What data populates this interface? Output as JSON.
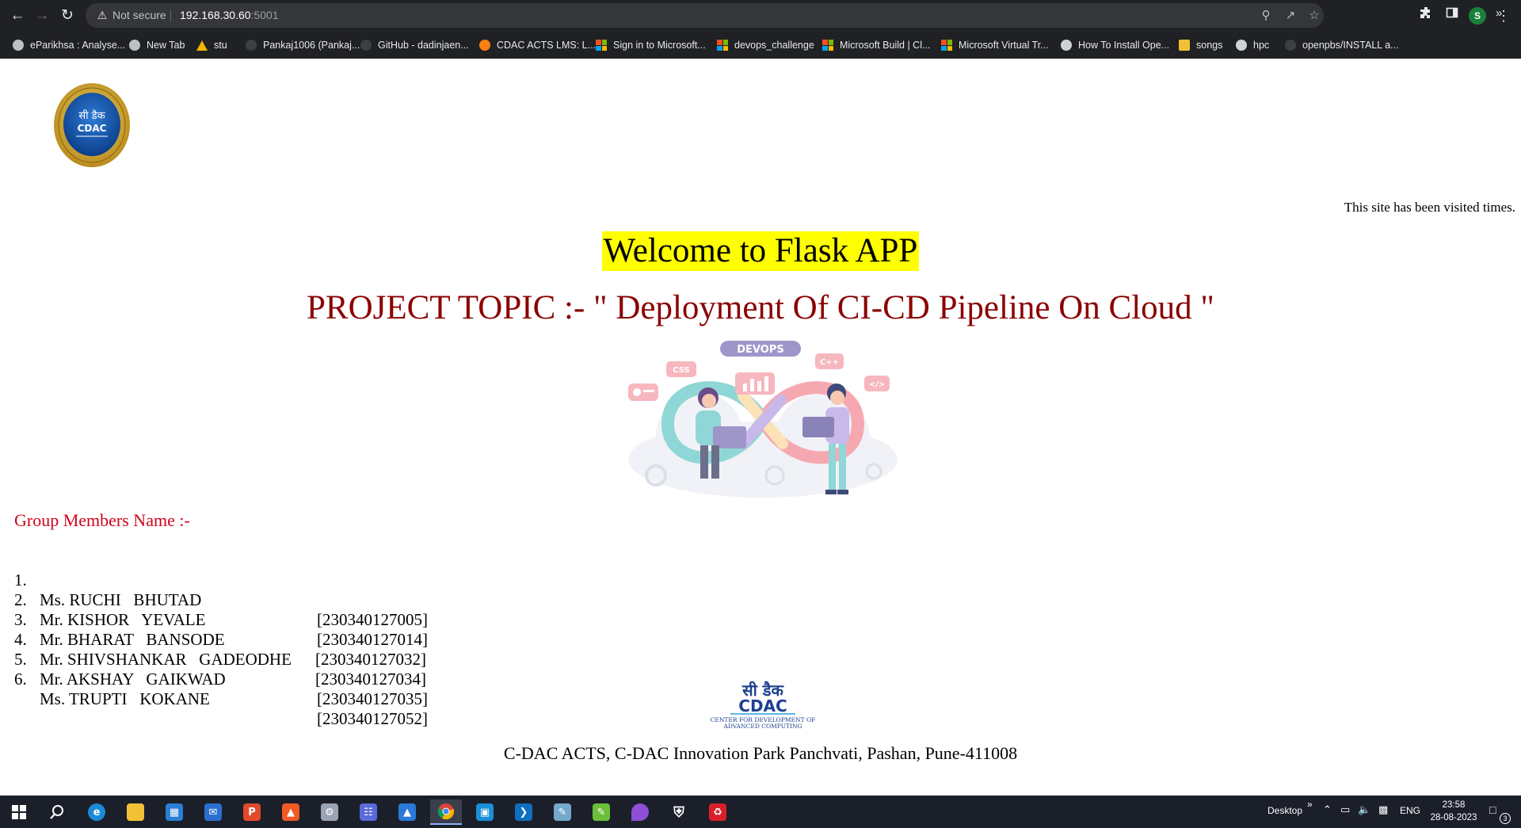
{
  "browser": {
    "security_label": "Not secure",
    "url_host": "192.168.30.60",
    "url_port": ":5001",
    "profile_initial": "S"
  },
  "bookmarks": [
    {
      "label": "eParikhsa : Analyse...",
      "icon": "globe-icon"
    },
    {
      "label": "New Tab",
      "icon": "chrome-icon"
    },
    {
      "label": "stu",
      "icon": "drive-icon"
    },
    {
      "label": "Pankaj1006 (Pankaj...",
      "icon": "github-icon"
    },
    {
      "label": "GitHub - dadinjaen...",
      "icon": "github-icon"
    },
    {
      "label": "CDAC ACTS LMS: L...",
      "icon": "moodle-icon"
    },
    {
      "label": "Sign in to Microsoft...",
      "icon": "microsoft-icon"
    },
    {
      "label": "devops_challenge",
      "icon": "microsoft-icon"
    },
    {
      "label": "Microsoft Build | Cl...",
      "icon": "microsoft-icon"
    },
    {
      "label": "Microsoft Virtual Tr...",
      "icon": "microsoft-icon"
    },
    {
      "label": "How To Install Ope...",
      "icon": "site-icon"
    },
    {
      "label": "songs",
      "icon": "folder-icon"
    },
    {
      "label": "hpc",
      "icon": "site-icon"
    },
    {
      "label": "openpbs/INSTALL a...",
      "icon": "github-icon"
    }
  ],
  "page": {
    "visit_counter": "This site has been visited times.",
    "welcome_title": "Welcome to Flask APP",
    "project_topic": "PROJECT TOPIC :- \" Deployment Of CI-CD Pipeline On Cloud \"",
    "illustration_labels": {
      "banner": "DEVOPS",
      "css": "CSS",
      "cpp": "C++",
      "code": "</>"
    },
    "members_heading": "Group Members Name :-",
    "members": [
      {
        "num": "1.",
        "name": "Ms. RUCHI   BHUTAD",
        "id": "[230340127005]"
      },
      {
        "num": "2.",
        "name": "Mr. KISHOR   YEVALE",
        "id": "[230340127014]"
      },
      {
        "num": "3.",
        "name": "Mr. BHARAT   BANSODE",
        "id": "[230340127032]"
      },
      {
        "num": "4.",
        "name": "Mr. SHIVSHANKAR   GADEODHE",
        "id": "[230340127034]"
      },
      {
        "num": "5.",
        "name": "Mr. AKSHAY   GAIKWAD",
        "id": "[230340127035]"
      },
      {
        "num": "6.",
        "name": "Ms. TRUPTI   KOKANE",
        "id": "[230340127052]"
      }
    ],
    "footer_logo": {
      "hindi": "सी डैक",
      "brand": "CDAC",
      "line1": "CENTER FOR DEVELOPMENT OF",
      "line2": "ADVANCED COMPUTING"
    },
    "badge_logo": {
      "hindi": "सी डैक",
      "brand": "CDAC"
    },
    "footer_address": "C-DAC ACTS, C-DAC Innovation Park Panchvati, Pashan, Pune-411008"
  },
  "taskbar": {
    "desktop_label": "Desktop",
    "more_label": "»",
    "language": "ENG",
    "time": "23:58",
    "date": "28-08-2023",
    "notification_count": "3"
  },
  "colors": {
    "highlight": "#ffff00",
    "topic": "#8b0000",
    "members_heading": "#d0021b"
  }
}
